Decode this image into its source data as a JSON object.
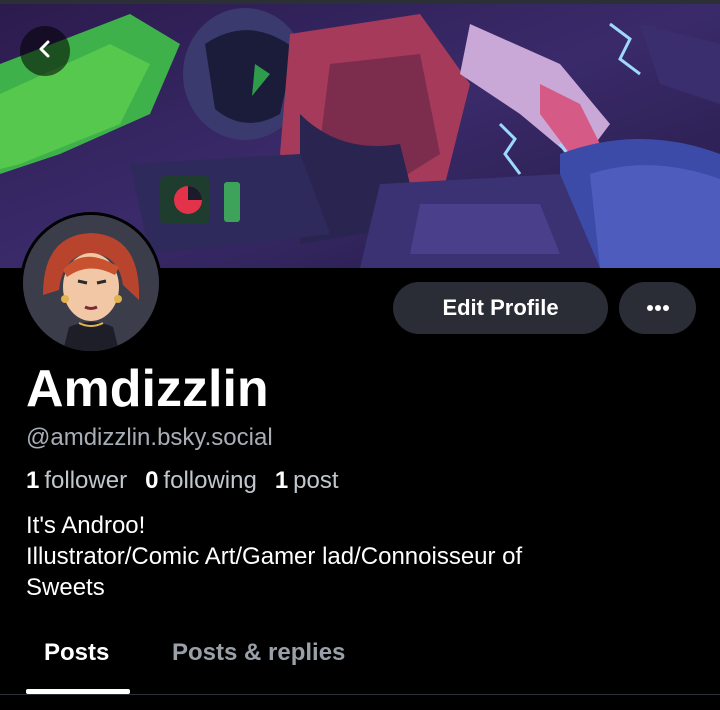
{
  "profile": {
    "display_name": "Amdizzlin",
    "handle": "@amdizzlin.bsky.social",
    "bio_lines": [
      "It's Androo!",
      "Illustrator/Comic Art/Gamer lad/Connoisseur of",
      "Sweets"
    ]
  },
  "stats": {
    "followers": {
      "count": "1",
      "label": "follower"
    },
    "following": {
      "count": "0",
      "label": "following"
    },
    "posts": {
      "count": "1",
      "label": "post"
    }
  },
  "actions": {
    "edit_profile_label": "Edit Profile",
    "more_icon": "ellipsis-icon",
    "back_icon": "chevron-left-icon"
  },
  "tabs": [
    {
      "label": "Posts",
      "active": true
    },
    {
      "label": "Posts & replies",
      "active": false
    }
  ],
  "colors": {
    "background": "#000000",
    "button_bg": "#2a2d35",
    "secondary_text": "#a8aeb8",
    "inactive_tab": "#9aa0a8"
  }
}
